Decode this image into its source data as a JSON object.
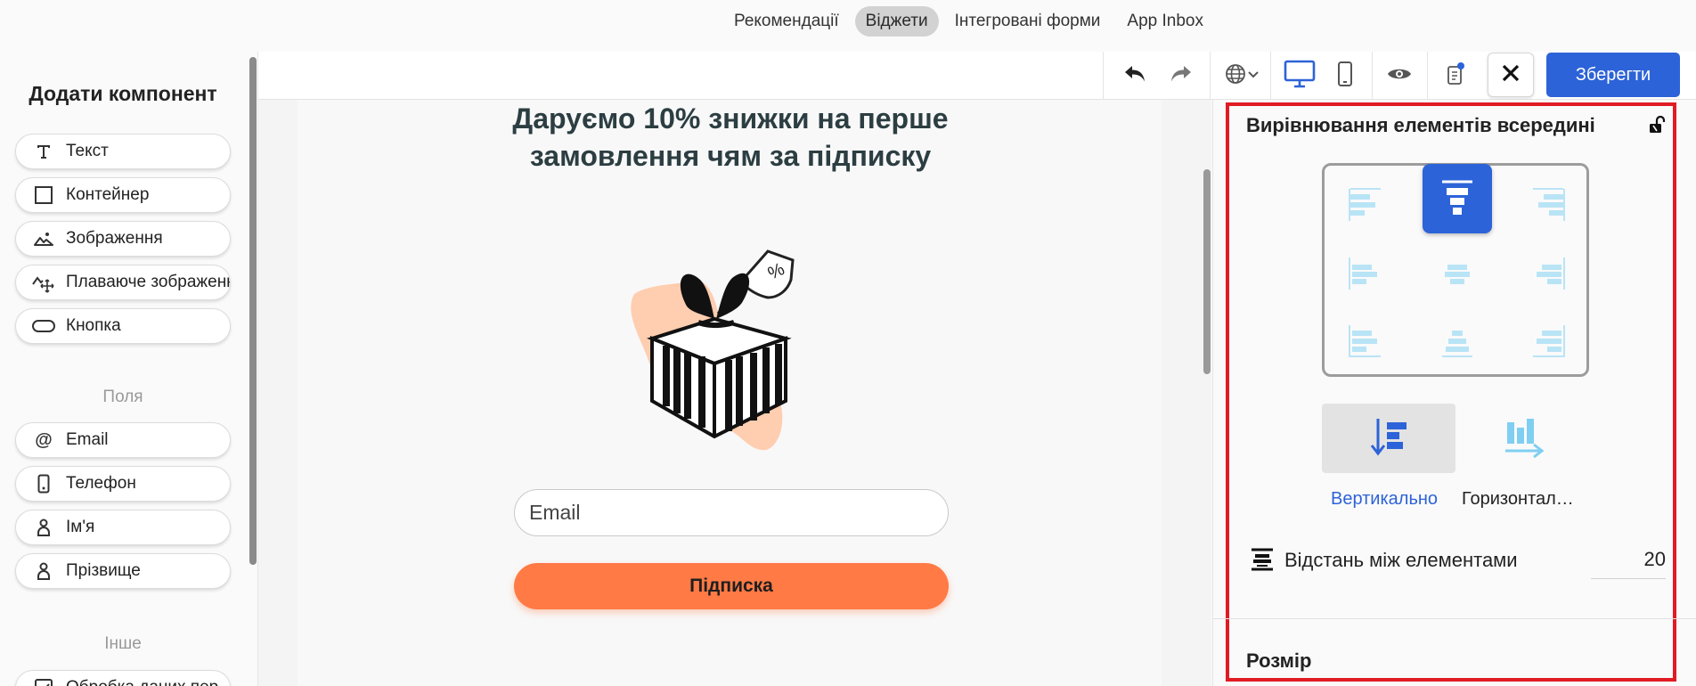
{
  "topnav": {
    "tabs": [
      {
        "label": "Рекомендації",
        "active": false
      },
      {
        "label": "Віджети",
        "active": true
      },
      {
        "label": "Інтегровані форми",
        "active": false
      },
      {
        "label": "App Inbox",
        "active": false
      }
    ]
  },
  "sidebar": {
    "title": "Додати компонент",
    "components": [
      {
        "label": "Текст",
        "icon": "text-icon"
      },
      {
        "label": "Контейнер",
        "icon": "container-icon"
      },
      {
        "label": "Зображення",
        "icon": "image-icon"
      },
      {
        "label": "Плаваюче зображення",
        "icon": "floating-image-icon"
      },
      {
        "label": "Кнопка",
        "icon": "button-icon"
      }
    ],
    "fields_label": "Поля",
    "fields": [
      {
        "label": "Email",
        "icon": "at-icon"
      },
      {
        "label": "Телефон",
        "icon": "phone-icon"
      },
      {
        "label": "Ім'я",
        "icon": "person-icon"
      },
      {
        "label": "Прізвище",
        "icon": "person-icon"
      }
    ],
    "other_label": "Інше",
    "other": [
      {
        "label": "Обробка даних пер…",
        "icon": "checkbox-icon"
      }
    ]
  },
  "toolbar": {
    "save_label": "Зберегти",
    "accent": "#2d63d8",
    "active_device": "desktop",
    "icons": [
      "undo-icon",
      "redo-icon",
      "globe-icon",
      "desktop-icon",
      "mobile-icon",
      "eye-icon",
      "clipboard-icon",
      "close-icon"
    ]
  },
  "canvas": {
    "headline": "Даруємо 10% знижки на перше замовлення чям за підписку",
    "email_placeholder": "Email",
    "button_label": "Підписка",
    "button_color": "#ff7a45"
  },
  "panel": {
    "title": "Вирівнювання елементів всередині",
    "alignment_selected": "top-center",
    "direction_vertical": "Вертикально",
    "direction_horizontal": "Горизонтал…",
    "direction_selected": "vertical",
    "spacing_label": "Відстань між елементами",
    "spacing_value": "20",
    "size_title": "Розмір",
    "highlight_color": "#e01b24"
  }
}
